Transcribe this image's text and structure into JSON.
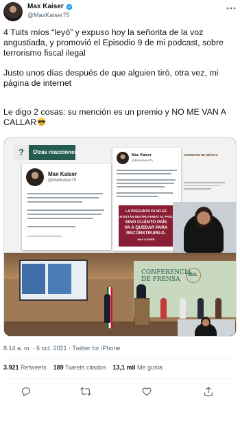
{
  "tweet": {
    "author_name": "Max Kaiser",
    "author_handle": "@MaxKaiser75",
    "paragraph_1": "4 Tuits míos “leyó” y expuso hoy la señorita de la voz angustiada, y promovió el Episodio 9 de mi podcast, sobre terrorismo fiscal ilegal",
    "paragraph_2": "Justo unos días después de que alguien tiró, otra vez, mi página de internet",
    "paragraph_3": "Le digo 2 cosas: su mención es un premio y NO ME VAN A CALLAR",
    "emoji": "sunglasses-emoji",
    "timestamp": "8:14 a. m. · 6 oct. 2021 · Twitter for iPhone"
  },
  "media": {
    "tag_label": "Otras reacciones",
    "card1_name": "Max Kaiser",
    "card1_handle": "@MaxKaiser75",
    "card2_name": "Max Kaiser",
    "card2_handle": "@MaxKaiser75",
    "quote_lines": [
      "LA PREGUNTA YA NO ES",
      "SI ESTÁN DESTRUYENDO AL PAÍS,",
      "SINO CUÁNTO PAÍS",
      "VA A QUEDAR PARA",
      "RECONSTRUIRLO."
    ],
    "quote_author": "MAX KAISER",
    "logo_text": "GOBIERNO DE MÉXICO",
    "conference_line1": "CONFERENCIA",
    "conference_line2": "DE PRENSA",
    "year": "2021"
  },
  "stats": {
    "retweets_count": "3.921",
    "retweets_label": "Retweets",
    "quotes_count": "189",
    "quotes_label": "Tweets citados",
    "likes_count": "13,1 mil",
    "likes_label": "Me gusta"
  },
  "colors": {
    "verified": "#1d9bf0",
    "brand_green": "#235b4e",
    "quote_bg": "#8a1e35",
    "secondary_text": "#536471"
  }
}
